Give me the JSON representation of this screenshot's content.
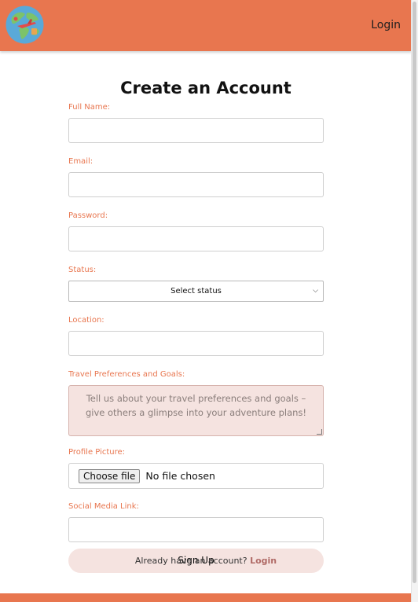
{
  "header": {
    "login_label": "Login"
  },
  "form": {
    "title": "Create an Account",
    "fields": {
      "full_name_label": "Full Name:",
      "email_label": "Email:",
      "password_label": "Password:",
      "status_label": "Status:",
      "status_selected": "Select status",
      "location_label": "Location:",
      "preferences_label": "Travel Preferences and Goals:",
      "preferences_placeholder": "Tell us about your travel preferences and goals – give others a glimpse into your adventure plans!",
      "profile_picture_label": "Profile Picture:",
      "choose_file_label": "Choose file",
      "no_file_text": "No file chosen",
      "social_media_label": "Social Media Link:"
    },
    "signup_label": "Sign Up",
    "account_prompt": "Already have an account?",
    "account_login_link": "Login"
  },
  "colors": {
    "brand": "#E8764F",
    "soft": "#F5E3E0",
    "link": "#b06a66"
  },
  "icons": {
    "logo": "globe-logo-icon",
    "select_arrow": "chevron-down-icon"
  }
}
